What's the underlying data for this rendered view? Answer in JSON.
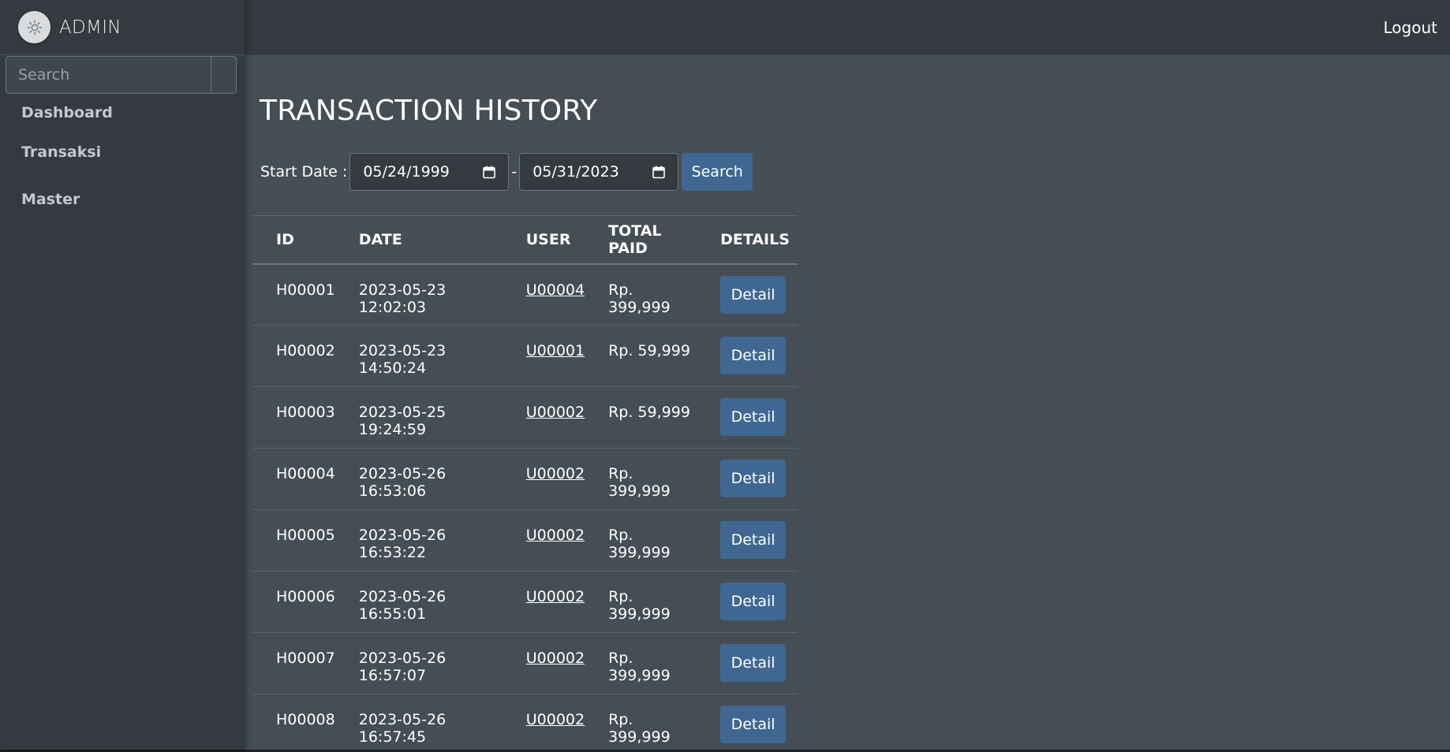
{
  "brand": {
    "name": "ADMIN",
    "logo_icon": "gear-icon"
  },
  "sidebar": {
    "search_placeholder": "Search",
    "items": [
      {
        "label": "Dashboard"
      },
      {
        "label": "Transaksi"
      },
      {
        "label": "Master"
      }
    ]
  },
  "topbar": {
    "logout_label": "Logout"
  },
  "main": {
    "title": "TRANSACTION HISTORY",
    "filter": {
      "label": "Start Date",
      "separator": ":",
      "start_date": "05/24/1999",
      "range_dash": "-",
      "end_date": "05/31/2023",
      "search_label": "Search"
    },
    "table": {
      "headers": [
        "ID",
        "DATE",
        "USER",
        "TOTAL PAID",
        "DETAILS"
      ],
      "rows": [
        {
          "id": "H00001",
          "date": "2023-05-23 12:02:03",
          "user": "U00004",
          "total": "Rp. 399,999",
          "action": "Detail"
        },
        {
          "id": "H00002",
          "date": "2023-05-23 14:50:24",
          "user": "U00001",
          "total": "Rp. 59,999",
          "action": "Detail"
        },
        {
          "id": "H00003",
          "date": "2023-05-25 19:24:59",
          "user": "U00002",
          "total": "Rp. 59,999",
          "action": "Detail"
        },
        {
          "id": "H00004",
          "date": "2023-05-26 16:53:06",
          "user": "U00002",
          "total": "Rp. 399,999",
          "action": "Detail"
        },
        {
          "id": "H00005",
          "date": "2023-05-26 16:53:22",
          "user": "U00002",
          "total": "Rp. 399,999",
          "action": "Detail"
        },
        {
          "id": "H00006",
          "date": "2023-05-26 16:55:01",
          "user": "U00002",
          "total": "Rp. 399,999",
          "action": "Detail"
        },
        {
          "id": "H00007",
          "date": "2023-05-26 16:57:07",
          "user": "U00002",
          "total": "Rp. 399,999",
          "action": "Detail"
        },
        {
          "id": "H00008",
          "date": "2023-05-26 16:57:45",
          "user": "U00002",
          "total": "Rp. 399,999",
          "action": "Detail"
        }
      ]
    }
  },
  "colors": {
    "sidebar_bg": "#343a40",
    "content_bg": "#454d55",
    "primary_button": "#3f6791"
  }
}
